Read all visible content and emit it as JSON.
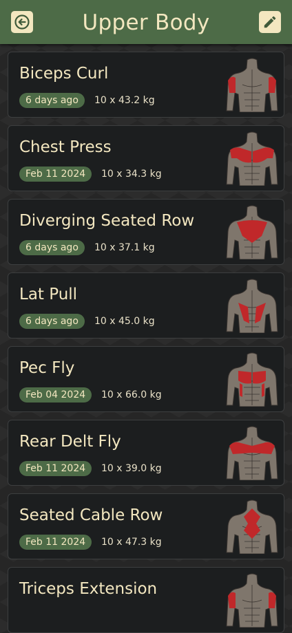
{
  "header": {
    "title": "Upper Body",
    "back_icon": "arrow-left-circle-icon",
    "edit_icon": "pencil-icon"
  },
  "colors": {
    "header_bg": "#4d6b47",
    "accent_cream": "#f3e7c0",
    "card_bg": "#1c1e1f",
    "muscle_highlight": "#c0282a",
    "body_gray": "#7f766c"
  },
  "exercises": [
    {
      "name": "Biceps Curl",
      "last_done": "6 days ago",
      "detail": "10 x 43.2 kg",
      "muscles": "biceps",
      "view": "front"
    },
    {
      "name": "Chest Press",
      "last_done": "Feb 11 2024",
      "detail": "10 x 34.3 kg",
      "muscles": "chest-shoulders",
      "view": "front"
    },
    {
      "name": "Diverging Seated Row",
      "last_done": "6 days ago",
      "detail": "10 x 37.1 kg",
      "muscles": "upper-back",
      "view": "back"
    },
    {
      "name": "Lat Pull",
      "last_done": "6 days ago",
      "detail": "10 x 45.0 kg",
      "muscles": "lats",
      "view": "back"
    },
    {
      "name": "Pec Fly",
      "last_done": "Feb 04 2024",
      "detail": "10 x 66.0 kg",
      "muscles": "chest-serratus",
      "view": "front"
    },
    {
      "name": "Rear Delt Fly",
      "last_done": "Feb 11 2024",
      "detail": "10 x 39.0 kg",
      "muscles": "rear-delts",
      "view": "back"
    },
    {
      "name": "Seated Cable Row",
      "last_done": "Feb 11 2024",
      "detail": "10 x 47.3 kg",
      "muscles": "mid-back",
      "view": "back"
    },
    {
      "name": "Triceps Extension",
      "last_done": "",
      "detail": "",
      "muscles": "triceps",
      "view": "back"
    }
  ]
}
